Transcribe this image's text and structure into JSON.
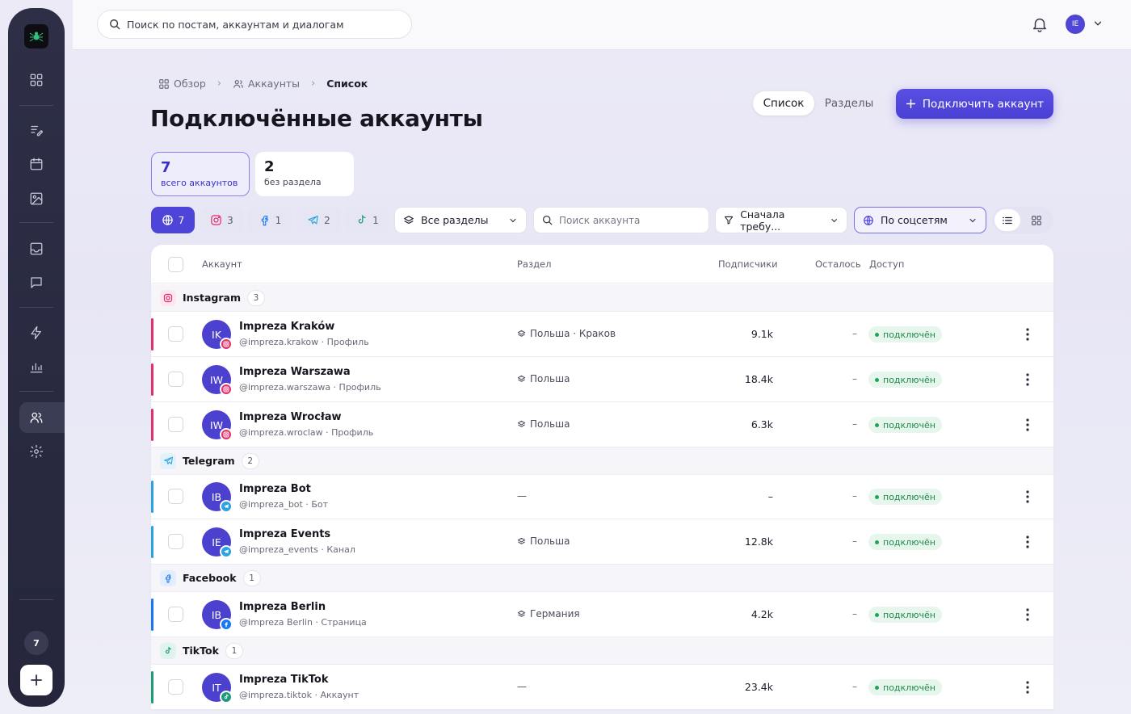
{
  "search": {
    "placeholder": "Поиск по постам, аккаунтам и диалогам"
  },
  "user": {
    "initials": "IE"
  },
  "sidebar": {
    "badge": "7"
  },
  "breadcrumb": {
    "overview": "Обзор",
    "accounts": "Аккаунты",
    "current": "Список"
  },
  "page": {
    "title": "Подключённые аккаунты"
  },
  "view_toggle": {
    "list": "Список",
    "sections": "Разделы"
  },
  "connect_button": {
    "label": "Подключить аккаунт"
  },
  "stats": [
    {
      "value": "7",
      "label": "всего аккаунтов"
    },
    {
      "value": "2",
      "label": "без раздела"
    }
  ],
  "filters": {
    "all_count": "7",
    "instagram_count": "3",
    "facebook_count": "1",
    "telegram_count": "2",
    "tiktok_count": "1",
    "sections_dropdown": "Все разделы",
    "account_search_placeholder": "Поиск аккаунта",
    "sort_dropdown": "Сначала требу...",
    "group_dropdown": "По соцсетям"
  },
  "table": {
    "headers": {
      "account": "Аккаунт",
      "section": "Раздел",
      "subscribers": "Подписчики",
      "remaining": "Осталось",
      "access": "Доступ"
    },
    "groups": [
      {
        "name": "Instagram",
        "count": "3"
      },
      {
        "name": "Telegram",
        "count": "2"
      },
      {
        "name": "Facebook",
        "count": "1"
      },
      {
        "name": "TikTok",
        "count": "1"
      }
    ],
    "rows": [
      {
        "initials": "IK",
        "name": "Impreza Kraków",
        "handle": "@impreza.krakow · Профиль",
        "section": "Польша · Краков",
        "subscribers": "9.1k",
        "remaining": "–",
        "status": "подключён"
      },
      {
        "initials": "IW",
        "name": "Impreza Warszawa",
        "handle": "@impreza.warszawa · Профиль",
        "section": "Польша",
        "subscribers": "18.4k",
        "remaining": "–",
        "status": "подключён"
      },
      {
        "initials": "IW",
        "name": "Impreza Wrocław",
        "handle": "@impreza.wroclaw · Профиль",
        "section": "Польша",
        "subscribers": "6.3k",
        "remaining": "–",
        "status": "подключён"
      },
      {
        "initials": "IB",
        "name": "Impreza Bot",
        "handle": "@impreza_bot · Бот",
        "section": "—",
        "subscribers": "–",
        "remaining": "–",
        "status": "подключён"
      },
      {
        "initials": "IE",
        "name": "Impreza Events",
        "handle": "@impreza_events · Канал",
        "section": "Польша",
        "subscribers": "12.8k",
        "remaining": "–",
        "status": "подключён"
      },
      {
        "initials": "IB",
        "name": "Impreza Berlin",
        "handle": "@Impreza Berlin · Страница",
        "section": "Германия",
        "subscribers": "4.2k",
        "remaining": "–",
        "status": "подключён"
      },
      {
        "initials": "IT",
        "name": "Impreza TikTok",
        "handle": "@impreza.tiktok · Аккаунт",
        "section": "—",
        "subscribers": "23.4k",
        "remaining": "–",
        "status": "подключён"
      }
    ]
  },
  "colors": {
    "accent": "#4f44d8",
    "sidebar": "#2b2c43",
    "instagram": "#e1306c",
    "telegram": "#2aa3e0",
    "facebook": "#1877f2",
    "tiktok": "#1f9a7a",
    "status_green": "#22a35a"
  }
}
